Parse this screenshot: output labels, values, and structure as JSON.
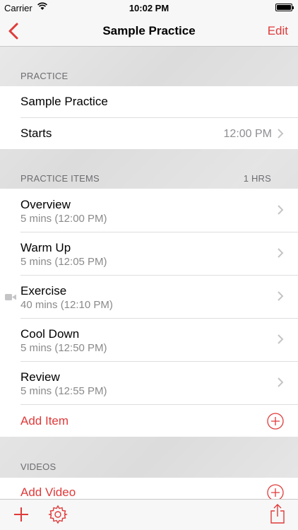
{
  "status_bar": {
    "carrier": "Carrier",
    "time": "10:02 PM"
  },
  "nav": {
    "title": "Sample Practice",
    "edit_label": "Edit"
  },
  "practice_section": {
    "header": "PRACTICE",
    "name": "Sample Practice",
    "starts_label": "Starts",
    "starts_value": "12:00 PM"
  },
  "items_section": {
    "header": "PRACTICE ITEMS",
    "total": "1 HRS",
    "items": [
      {
        "title": "Overview",
        "detail": "5 mins (12:00 PM)"
      },
      {
        "title": "Warm Up",
        "detail": "5 mins (12:05 PM)"
      },
      {
        "title": "Exercise",
        "detail": "40 mins (12:10 PM)"
      },
      {
        "title": "Cool Down",
        "detail": "5 mins (12:50 PM)"
      },
      {
        "title": "Review",
        "detail": "5 mins (12:55 PM)"
      }
    ],
    "add_label": "Add Item"
  },
  "videos_section": {
    "header": "VIDEOS",
    "add_label": "Add Video"
  },
  "colors": {
    "accent": "#e03a3a",
    "secondary_text": "#8a8a8a"
  },
  "icons": [
    "back-chevron-icon",
    "video-camera-icon",
    "chevron-right-icon",
    "plus-circle-icon",
    "plus-icon",
    "gear-icon",
    "share-icon"
  ]
}
